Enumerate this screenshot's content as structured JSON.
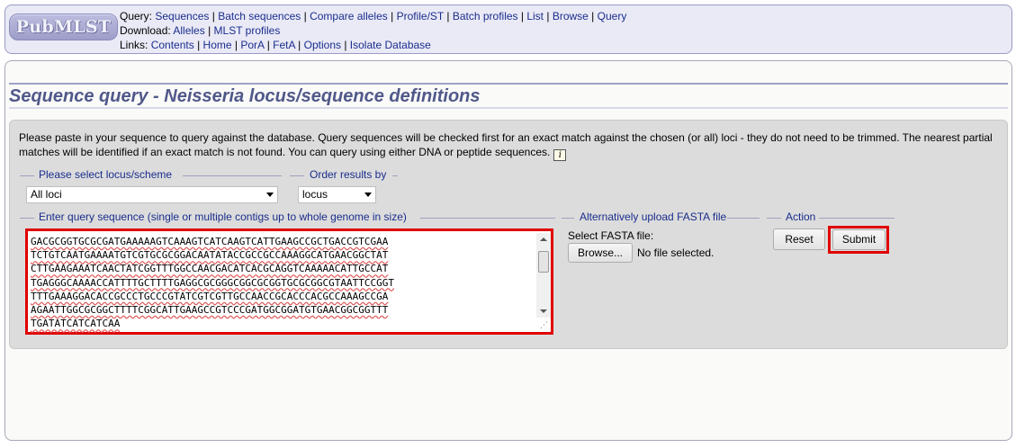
{
  "header": {
    "logo_text": "PubMLST",
    "query_label": "Query:",
    "query_links": [
      "Sequences",
      "Batch sequences",
      "Compare alleles",
      "Profile/ST",
      "Batch profiles",
      "List",
      "Browse",
      "Query"
    ],
    "download_label": "Download:",
    "download_links": [
      "Alleles",
      "MLST profiles"
    ],
    "links_label": "Links:",
    "links": [
      "Contents",
      "Home",
      "PorA",
      "FetA",
      "Options",
      "Isolate Database"
    ]
  },
  "page_title": "Sequence query - Neisseria locus/sequence definitions",
  "intro_text": "Please paste in your sequence to query against the database. Query sequences will be checked first for an exact match against the chosen (or all) loci - they do not need to be trimmed. The nearest partial matches will be identified if an exact match is not found. You can query using either DNA or peptide sequences.",
  "info_icon_glyph": "i",
  "locus": {
    "legend": "Please select locus/scheme",
    "selected": "All loci"
  },
  "order": {
    "legend": "Order results by",
    "selected": "locus"
  },
  "sequence": {
    "legend": "Enter query sequence (single or multiple contigs up to whole genome in size)",
    "lines": [
      "GACGCGGTGCGCGATGAAAAAGTCAAAGTCATCAAGTCATTGAAGCCGCTGACCGTCGAA",
      "TCTGTCAATGAAAATGTCGTGCGCGGACAATATACCGCCGCCAAAGGCATGAACGGCTAT",
      "CTTGAAGAAATCAACTATCGGTTTGGCCAACGACATCACGCAGGTCAAAAACATTGCCAT",
      "TGAGGGCAAAACCATTTTGCTTTTGAGGCGCGGGCGGCGCGGTGCGCGGCGTAATTCCGGT",
      "TTTGAAAGGACACCGCCCTGCCCGTATCGTCGTTGCCAACCGCACCCACGCCAAAGCCGA",
      "AGAATTGGCGCGGCTTTTCGGCATTGAAGCCGTCCCGATGGCGGATGTGAACGGCGGTTT",
      "TGATATCATCATCAA"
    ]
  },
  "upload": {
    "legend": "Alternatively upload FASTA file",
    "label": "Select FASTA file:",
    "browse_label": "Browse...",
    "status": "No file selected."
  },
  "action": {
    "legend": "Action",
    "reset_label": "Reset",
    "submit_label": "Submit"
  },
  "colors": {
    "link": "#1a2d8c",
    "title": "#50588a",
    "highlight": "#e00000"
  }
}
